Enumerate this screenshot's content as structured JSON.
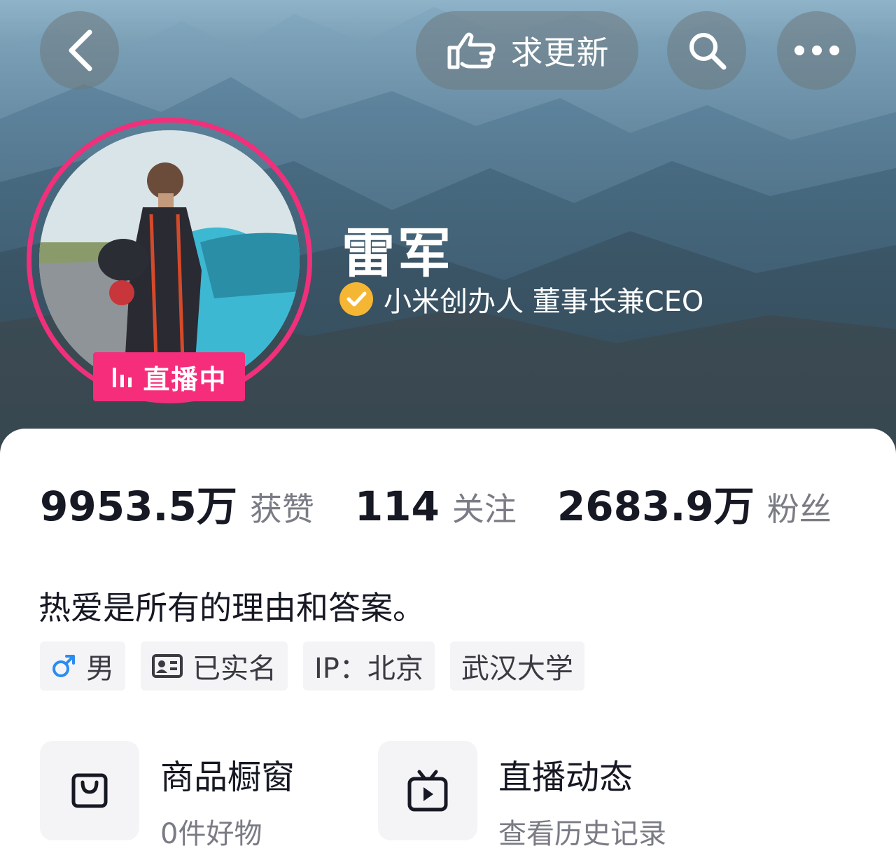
{
  "header": {
    "update_button_label": "求更新",
    "icons": [
      "back-chevron-icon",
      "hand-pointing-icon",
      "search-icon",
      "more-dots-icon"
    ]
  },
  "profile": {
    "username": "雷军",
    "verified_title": "小米创办人 董事长兼CEO",
    "live_badge_label": "直播中",
    "colors": {
      "live_pink": "#f52d7b",
      "verify_gold": "#f5b733"
    }
  },
  "stats": [
    {
      "value": "9953.5万",
      "label": "获赞"
    },
    {
      "value": "114",
      "label": "关注"
    },
    {
      "value": "2683.9万",
      "label": "粉丝"
    }
  ],
  "bio": "热爱是所有的理由和答案。",
  "tags": [
    {
      "icon": "male-symbol-icon",
      "label": "男"
    },
    {
      "icon": "id-card-icon",
      "label": "已实名"
    },
    {
      "icon": "",
      "label": "IP：北京"
    },
    {
      "icon": "",
      "label": "武汉大学"
    }
  ],
  "entries": [
    {
      "icon": "shopping-bag-icon",
      "title": "商品橱窗",
      "subtitle": "0件好物"
    },
    {
      "icon": "tv-play-icon",
      "title": "直播动态",
      "subtitle": "查看历史记录"
    }
  ]
}
